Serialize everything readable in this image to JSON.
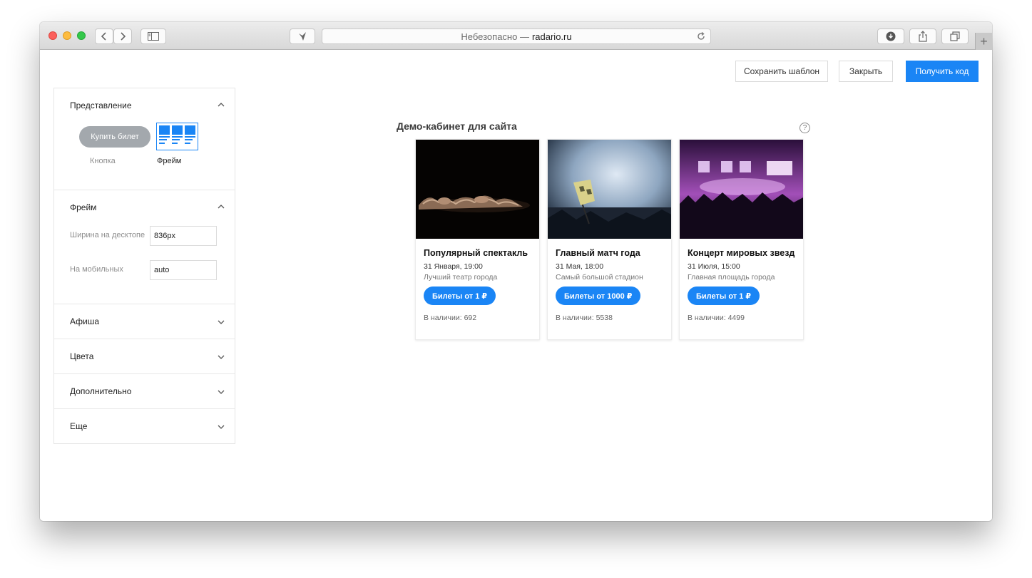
{
  "browser": {
    "url_prefix": "Небезопасно —",
    "url_domain": "radario.ru"
  },
  "toolbar": {
    "save_template": "Сохранить шаблон",
    "close": "Закрыть",
    "get_code": "Получить код"
  },
  "sidebar": {
    "view_section": {
      "title": "Представление",
      "button_preview": "Купить билет",
      "button_label": "Кнопка",
      "frame_label": "Фрейм"
    },
    "frame_section": {
      "title": "Фрейм",
      "desktop_width_label": "Ширина на десктопе",
      "desktop_width_value": "836px",
      "mobile_label": "На мобильных",
      "mobile_value": "auto"
    },
    "sections": [
      {
        "title": "Афиша"
      },
      {
        "title": "Цвета"
      },
      {
        "title": "Дополнительно"
      },
      {
        "title": "Еще"
      }
    ]
  },
  "main": {
    "title": "Демо-кабинет для сайта",
    "help_icon": "?"
  },
  "events": [
    {
      "title": "Популярный спектакль",
      "date": "31 Января, 19:00",
      "venue": "Лучший театр города",
      "button": "Билеты от 1 ₽",
      "stock": "В наличии: 692",
      "image": "theatre"
    },
    {
      "title": "Главный матч года",
      "date": "31 Мая, 18:00",
      "venue": "Самый большой стадион",
      "button": "Билеты от 1000 ₽",
      "stock": "В наличии: 5538",
      "image": "stadium"
    },
    {
      "title": "Концерт мировых звезд",
      "date": "31 Июля, 15:00",
      "venue": "Главная площадь города",
      "button": "Билеты от 1 ₽",
      "stock": "В наличии: 4499",
      "image": "concert"
    }
  ],
  "colors": {
    "accent": "#1a85f5",
    "pill_gray": "#a3a8ad"
  },
  "icons": {
    "back": "chevron-left-icon",
    "forward": "chevron-right-icon",
    "sidebar": "sidebar-icon",
    "extension": "bird-icon",
    "reload": "reload-icon",
    "download": "download-icon",
    "share": "share-icon",
    "tabs": "tabs-icon",
    "new_tab": "plus-icon",
    "collapse": "chevron-up-icon",
    "expand": "chevron-down-icon",
    "help": "help-icon"
  }
}
